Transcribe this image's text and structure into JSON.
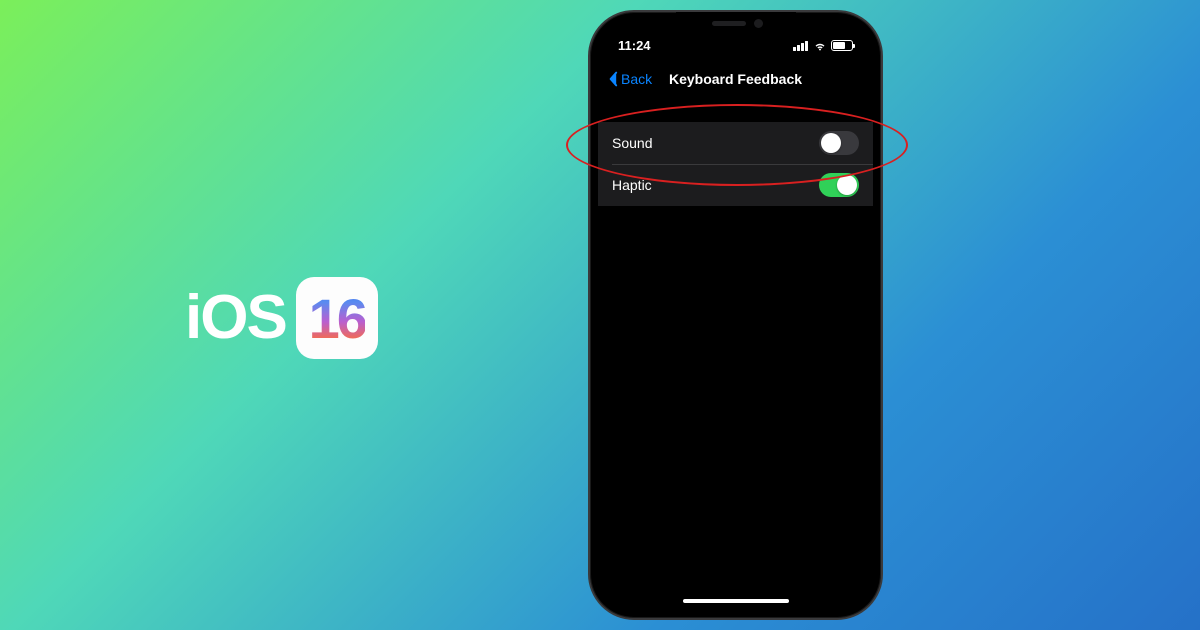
{
  "logo": {
    "text_prefix": "iOS",
    "version": "16"
  },
  "status_bar": {
    "time": "11:24"
  },
  "nav": {
    "back_label": "Back",
    "title": "Keyboard Feedback"
  },
  "settings": {
    "rows": [
      {
        "label": "Sound",
        "on": false
      },
      {
        "label": "Haptic",
        "on": true
      }
    ]
  }
}
